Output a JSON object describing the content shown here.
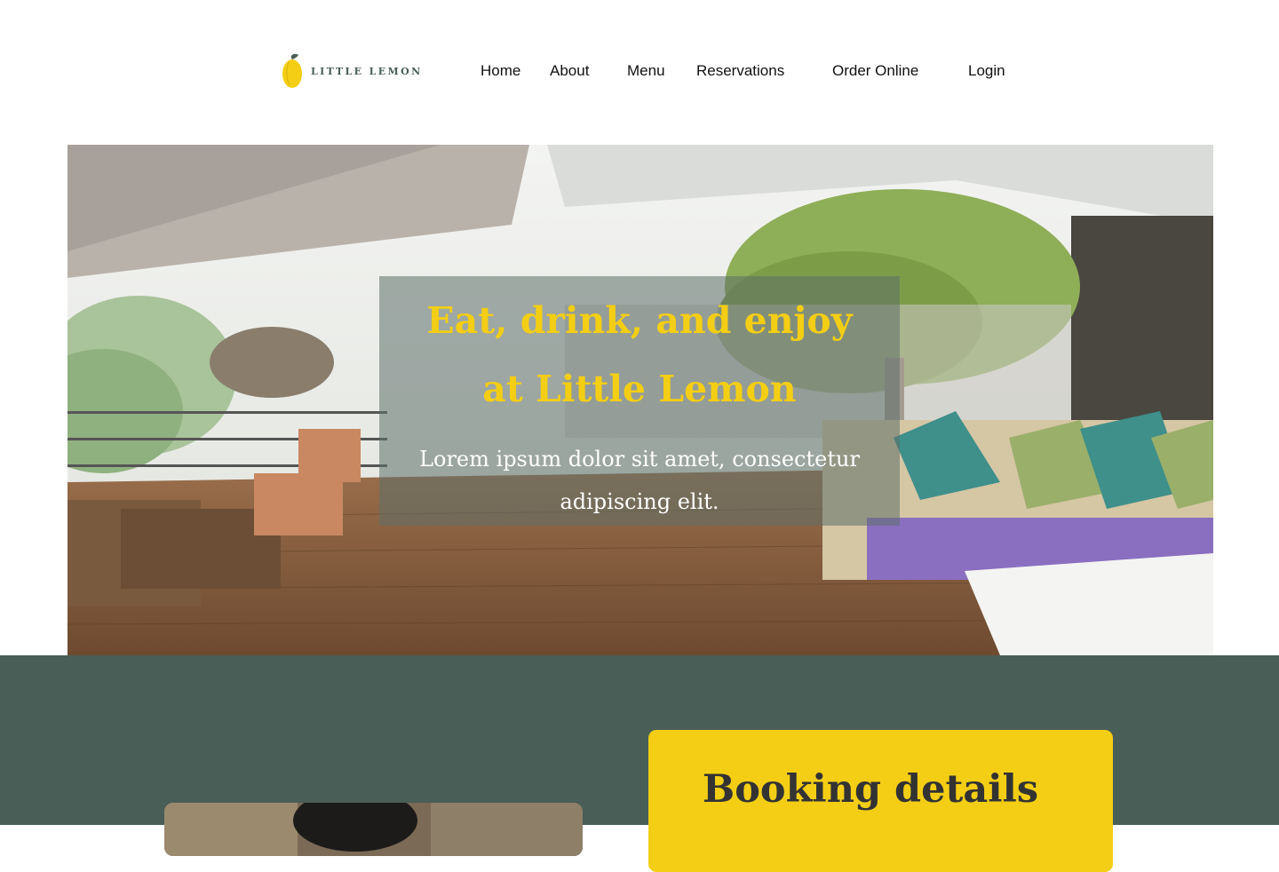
{
  "brand": {
    "name": "LITTLE LEMON",
    "colors": {
      "primary_green": "#495e57",
      "primary_yellow": "#f4ce14",
      "text_dark": "#333333"
    }
  },
  "nav": {
    "home": "Home",
    "about": "About",
    "menu": "Menu",
    "reservations": "Reservations",
    "order_online": "Order Online",
    "login": "Login"
  },
  "hero": {
    "title_line1": "Eat, drink, and enjoy",
    "title_line2": "at Little Lemon",
    "subtitle_line1": "Lorem ipsum dolor sit amet, consectetur",
    "subtitle_line2": "adipiscing elit.",
    "image": "restaurant-terrace-photo"
  },
  "booking": {
    "title": "Booking details"
  },
  "icons": {
    "logo": "lemon-logo-icon"
  }
}
